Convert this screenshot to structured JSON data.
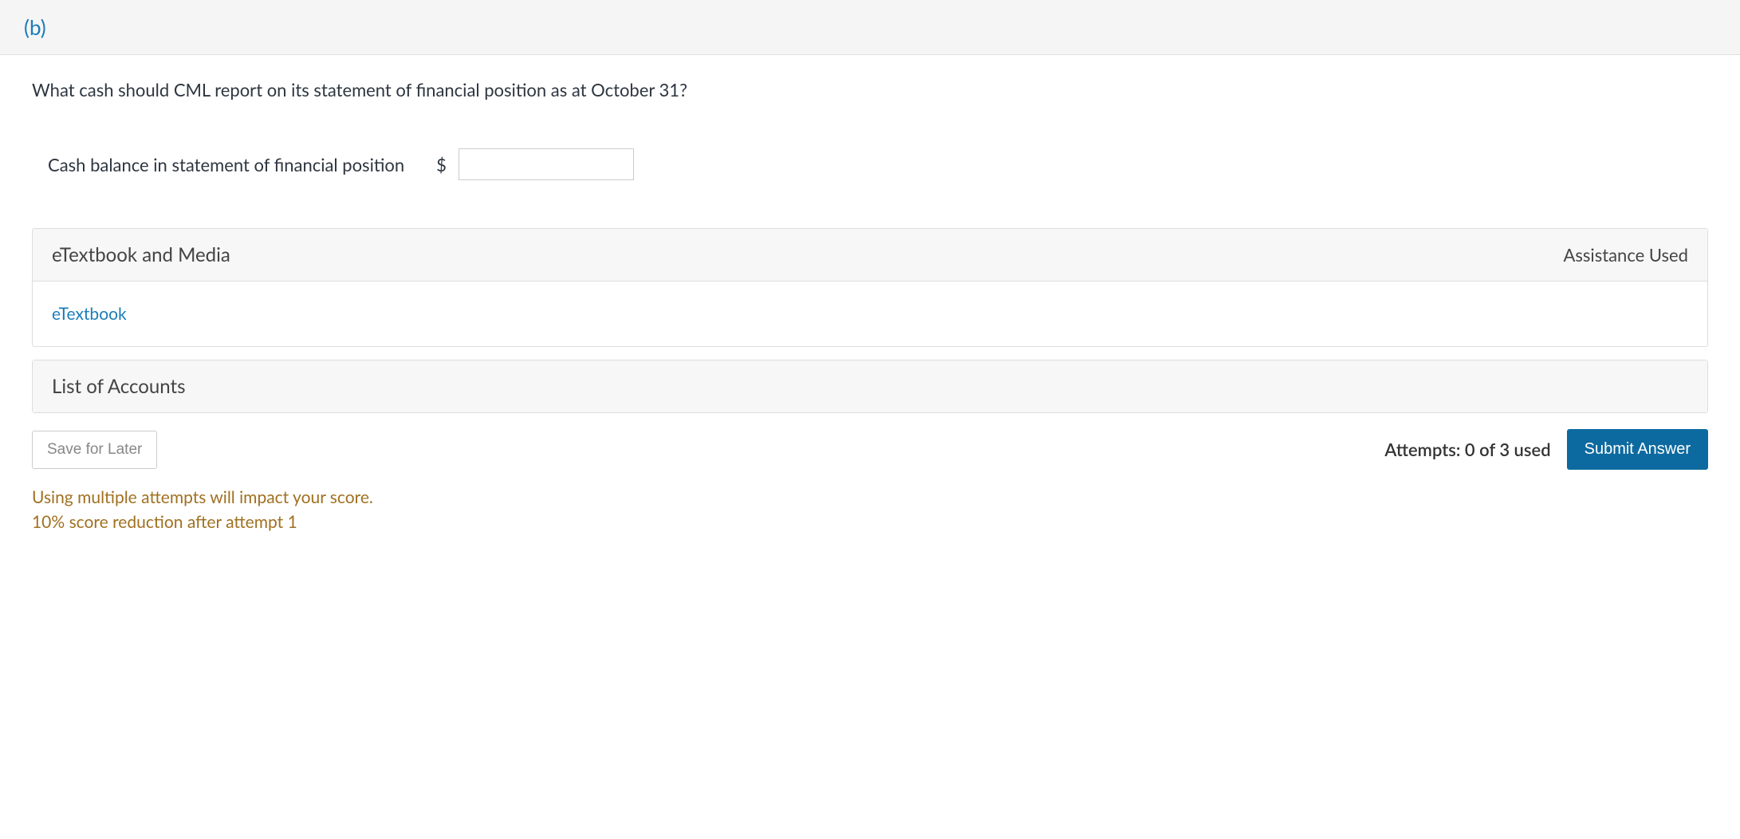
{
  "part": {
    "label": "(b)"
  },
  "question": {
    "text": "What cash should CML report on its statement of financial position as at October 31?"
  },
  "input": {
    "label": "Cash balance in statement of financial position",
    "currency": "$",
    "value": ""
  },
  "panels": {
    "etextbook_media": {
      "title": "eTextbook and Media",
      "assistance": "Assistance Used",
      "link": "eTextbook"
    },
    "list_of_accounts": {
      "title": "List of Accounts"
    }
  },
  "footer": {
    "save_label": "Save for Later",
    "attempts": "Attempts: 0 of 3 used",
    "submit_label": "Submit Answer"
  },
  "warnings": {
    "line1": "Using multiple attempts will impact your score.",
    "line2": "10% score reduction after attempt 1"
  }
}
